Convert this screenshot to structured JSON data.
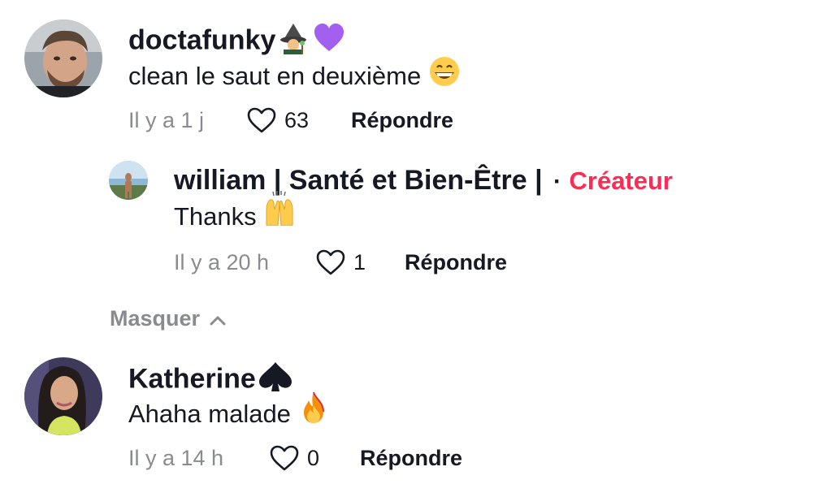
{
  "comments": [
    {
      "username": "doctafunky",
      "text": "clean le saut en deuxième",
      "time": "Il y a 1 j",
      "likes": "63",
      "reply_label": "Répondre",
      "emoji": [
        "mage-icon",
        "purple-heart-icon",
        "grinning-face-icon"
      ]
    },
    {
      "username": "william | Santé et Bien-Être |",
      "separator": "·",
      "badge": "Créateur",
      "text": "Thanks",
      "time": "Il y a 20 h",
      "likes": "1",
      "reply_label": "Répondre",
      "emoji": [
        "raising-hands-icon"
      ]
    },
    {
      "username": "Katherine",
      "text": "Ahaha malade",
      "time": "Il y a 14 h",
      "likes": "0",
      "reply_label": "Répondre",
      "emoji": [
        "spade-icon",
        "fire-icon"
      ]
    }
  ],
  "hide_replies_label": "Masquer",
  "colors": {
    "text": "#161823",
    "muted": "#8a8b91",
    "creator_badge": "#fe2c55"
  }
}
